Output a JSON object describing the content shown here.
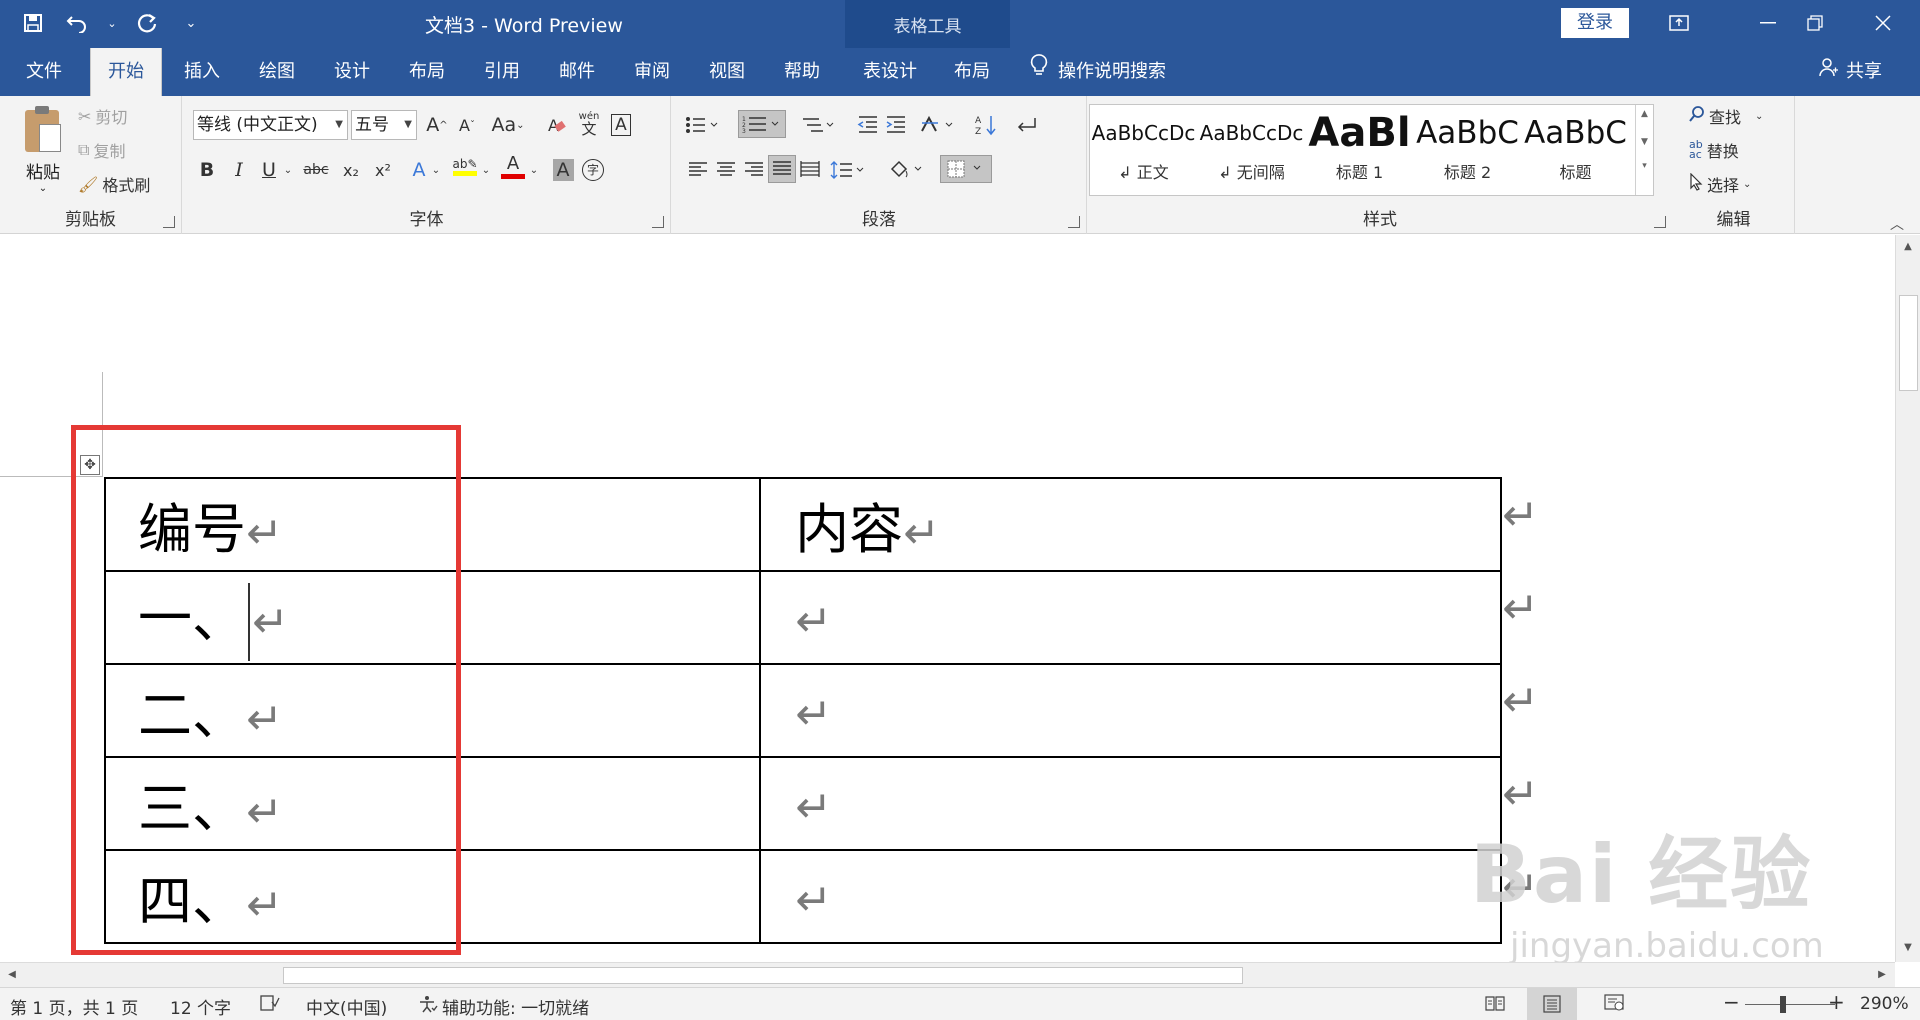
{
  "titlebar": {
    "title": "文档3  -  Word Preview",
    "context_tools": "表格工具",
    "login": "登录",
    "qat_icons": [
      "save-icon",
      "undo-icon",
      "redo-icon",
      "customize-qat-icon"
    ]
  },
  "tabs": {
    "file": "文件",
    "home": "开始",
    "insert": "插入",
    "draw": "绘图",
    "design": "设计",
    "layout": "布局",
    "references": "引用",
    "mailings": "邮件",
    "review": "审阅",
    "view": "视图",
    "help": "帮助",
    "table_design": "表设计",
    "table_layout": "布局",
    "tell_me": "操作说明搜索",
    "share": "共享",
    "active": "开始"
  },
  "ribbon": {
    "clipboard": {
      "label": "剪贴板",
      "paste": "粘贴",
      "cut": "剪切",
      "copy": "复制",
      "format_painter": "格式刷"
    },
    "font": {
      "label": "字体",
      "font_name": "等线 (中文正文)",
      "font_size": "五号",
      "grow": "A",
      "shrink": "A",
      "change_case": "Aa",
      "phonetic_top": "wén",
      "phonetic_bottom": "文",
      "bold": "B",
      "italic": "I",
      "underline": "U",
      "strike": "abc",
      "subscript": "x₂",
      "superscript": "x²",
      "font_color": "A",
      "char_shading": "A",
      "enclose": "字"
    },
    "paragraph": {
      "label": "段落"
    },
    "styles": {
      "label": "样式",
      "items": [
        {
          "preview": "AaBbCcDc",
          "name": "↲ 正文"
        },
        {
          "preview": "AaBbCcDc",
          "name": "↲ 无间隔"
        },
        {
          "preview": "AaBl",
          "name": "标题 1"
        },
        {
          "preview": "AaBbC",
          "name": "标题 2"
        },
        {
          "preview": "AaBbC",
          "name": "标题"
        }
      ]
    },
    "editing": {
      "label": "编辑",
      "find": "查找",
      "replace": "替换",
      "select": "选择"
    }
  },
  "table": {
    "rows": [
      {
        "col1": "编号",
        "col2": "内容"
      },
      {
        "col1": "一、",
        "col2": ""
      },
      {
        "col1": "二、",
        "col2": ""
      },
      {
        "col1": "三、",
        "col2": ""
      },
      {
        "col1": "四、",
        "col2": ""
      }
    ],
    "para_mark": "↵"
  },
  "watermark": {
    "brand": "Bai  经验",
    "url": "jingyan.baidu.com"
  },
  "statusbar": {
    "page": "第 1 页，共 1 页",
    "words": "12 个字",
    "language": "中文(中国)",
    "accessibility": "辅助功能: 一切就绪",
    "zoom_minus": "−",
    "zoom_plus": "+",
    "zoom": "290%"
  },
  "colors": {
    "brand": "#2b579a",
    "highlight_box": "#e53935",
    "font_color_bar": "#e00000",
    "highlight_color_bar": "#ffff00"
  }
}
